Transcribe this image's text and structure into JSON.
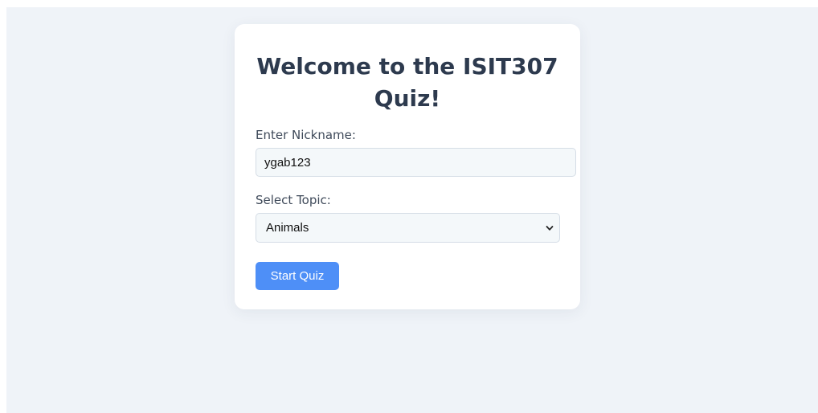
{
  "quiz": {
    "title": "Welcome to the ISIT307 Quiz!",
    "nickname_label": "Enter Nickname:",
    "nickname_value": "ygab123",
    "topic_label": "Select Topic:",
    "topic_selected": "Animals",
    "start_button_label": "Start Quiz"
  },
  "icons": {
    "select_arrow": "chevron-down-icon"
  },
  "colors": {
    "page_background": "#eff3f8",
    "card_background": "#ffffff",
    "title_text": "#2d3a4e",
    "button_background": "#4e8ff7",
    "field_background": "#f4f8fa"
  }
}
